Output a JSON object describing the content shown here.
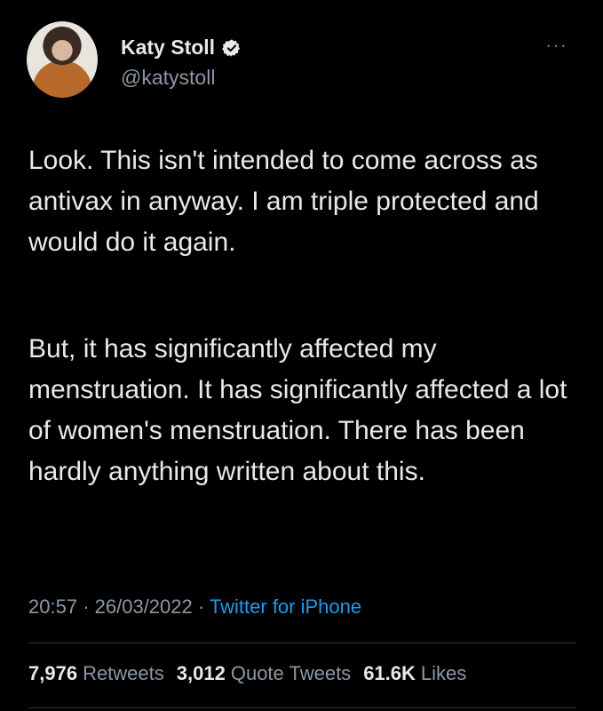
{
  "author": {
    "display_name": "Katy Stoll",
    "handle": "@katystoll",
    "verified_icon": "verified-badge-icon",
    "avatar": "avatar"
  },
  "menu_icon": "more-options-icon",
  "more_glyph": "···",
  "tweet": {
    "paragraph_1": "Look. This isn't intended to come across as antivax in anyway. I am triple protected and would do it again.",
    "paragraph_2": "But, it has significantly affected my menstruation. It has significantly affected a lot of women's menstruation. There has been hardly anything written about this."
  },
  "meta": {
    "time": "20:57",
    "separator": "·",
    "date": "26/03/2022",
    "source": "Twitter for iPhone"
  },
  "stats": {
    "retweets_count": "7,976",
    "retweets_label": "Retweets",
    "quotes_count": "3,012",
    "quotes_label": "Quote Tweets",
    "likes_count": "61.6K",
    "likes_label": "Likes"
  },
  "colors": {
    "background": "#000000",
    "text": "#e7e9ea",
    "secondary": "#8b98a5",
    "link": "#1d9bf0",
    "divider": "#2f3336"
  }
}
